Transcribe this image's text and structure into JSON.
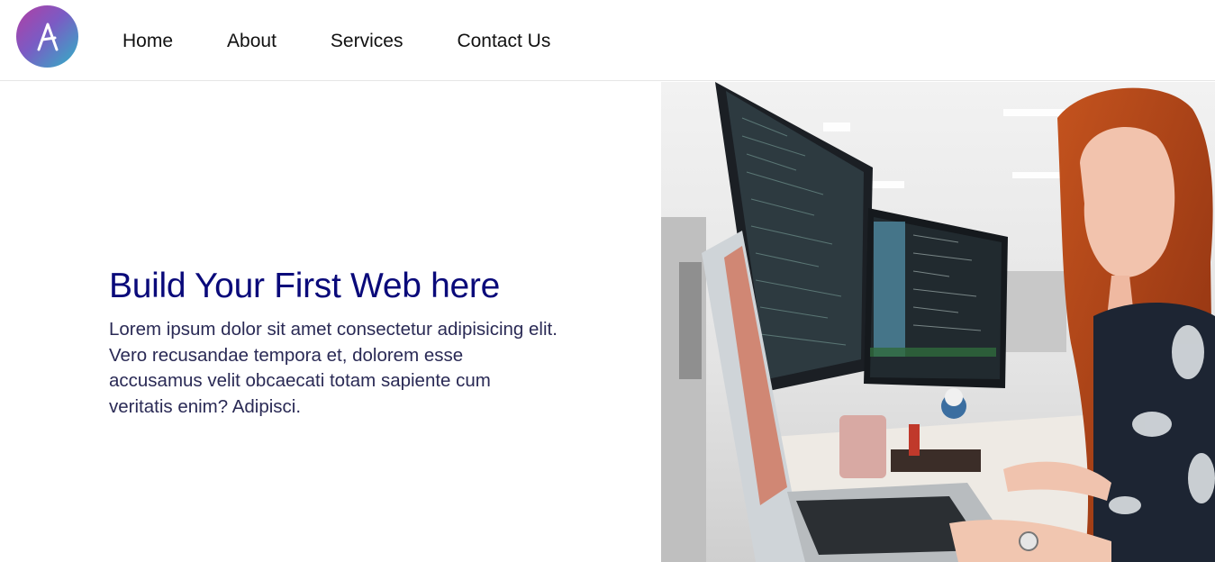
{
  "nav": {
    "logo_letter": "A",
    "links": [
      "Home",
      "About",
      "Services",
      "Contact Us"
    ]
  },
  "hero": {
    "title": "Build Your First Web here",
    "description": "Lorem ipsum dolor sit amet consectetur adipisicing elit. Vero recusandae tempora et, dolorem esse accusamus velit obcaecati totam sapiente cum veritatis enim? Adipisci."
  },
  "colors": {
    "title": "#0a0a7a",
    "text": "#2a2a55",
    "logo_gradient": [
      "#b23ea3",
      "#7b5bc4",
      "#2fb3c6"
    ]
  },
  "icons": {
    "logo": "a-logo-icon"
  }
}
